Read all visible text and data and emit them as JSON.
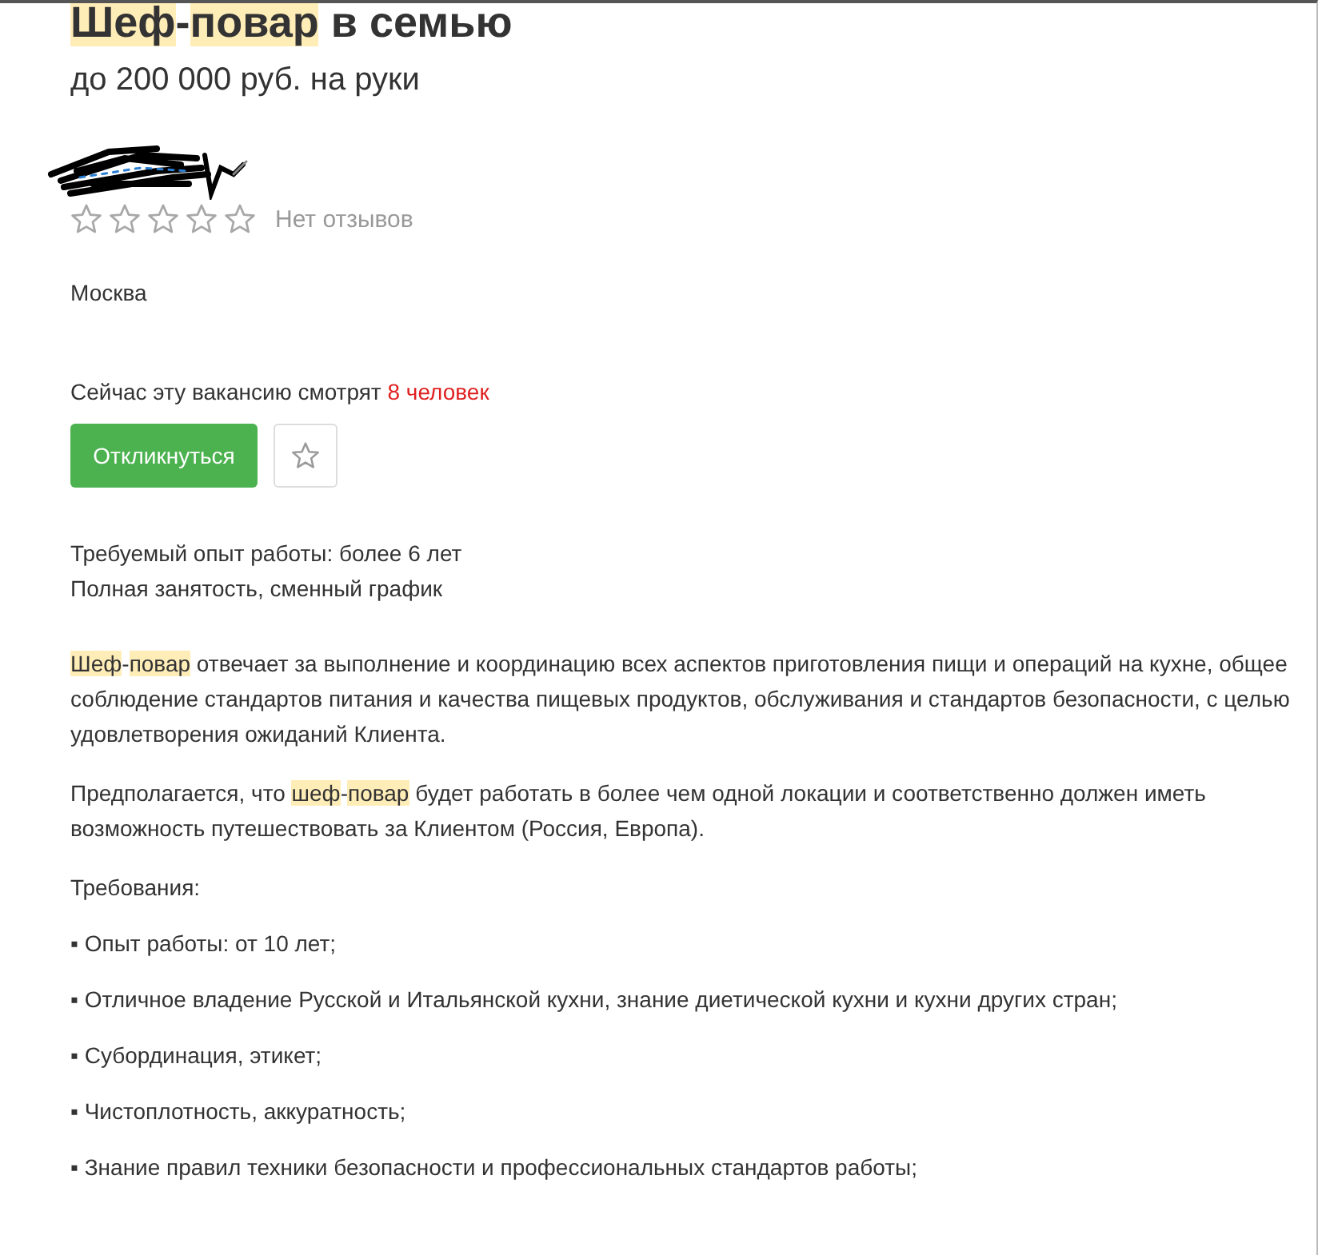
{
  "title": {
    "parts": [
      {
        "text": "Шеф",
        "highlighted": true
      },
      {
        "text": "-",
        "highlighted": false
      },
      {
        "text": "повар",
        "highlighted": true
      },
      {
        "text": " в семью",
        "highlighted": false
      }
    ]
  },
  "salary": "до 200 000 руб. на руки",
  "rating": {
    "stars": 0,
    "reviews": "Нет отзывов"
  },
  "city": "Москва",
  "viewers": {
    "text": "Сейчас эту вакансию смотрят ",
    "count": "8 человек"
  },
  "respond_button": "Откликнуться",
  "favorite": {
    "selected": false
  },
  "conditions": [
    "Требуемый опыт работы: более 6 лет",
    "Полная занятость, сменный график"
  ],
  "description": [
    {
      "kind": "paragraph",
      "parts": [
        {
          "text": "Шеф",
          "highlighted": true
        },
        {
          "text": "-",
          "highlighted": false
        },
        {
          "text": "повар",
          "highlighted": true
        },
        {
          "text": " отвечает за выполнение и координацию всех аспектов приготовления пищи и операций на кухне, общее соблюдение стандартов питания и качества пищевых продуктов, обслуживания и стандартов безопасности, с целью удовлетворения ожиданий Клиента.",
          "highlighted": false
        }
      ]
    },
    {
      "kind": "paragraph",
      "parts": [
        {
          "text": "Предполагается, что ",
          "highlighted": false
        },
        {
          "text": "шеф",
          "highlighted": true
        },
        {
          "text": "-",
          "highlighted": false
        },
        {
          "text": "повар",
          "highlighted": true
        },
        {
          "text": " будет работать в более чем одной локации и соответственно должен иметь возможность путешествовать за Клиентом (Россия, Европа).",
          "highlighted": false
        }
      ]
    },
    {
      "kind": "heading",
      "parts": [
        {
          "text": "Требования:",
          "highlighted": false
        }
      ]
    },
    {
      "kind": "item",
      "parts": [
        {
          "text": "▪ Опыт работы: от 10 лет;",
          "highlighted": false
        }
      ]
    },
    {
      "kind": "item",
      "parts": [
        {
          "text": "▪ Отличное владение Русской и Итальянской кухни, знание диетической кухни и кухни других стран;",
          "highlighted": false
        }
      ]
    },
    {
      "kind": "item",
      "parts": [
        {
          "text": "▪ Субординация, этикет;",
          "highlighted": false
        }
      ]
    },
    {
      "kind": "item",
      "parts": [
        {
          "text": "▪ Чистоплотность, аккуратность;",
          "highlighted": false
        }
      ]
    },
    {
      "kind": "item",
      "parts": [
        {
          "text": "▪ Знание правил техники безопасности и профессиональных стандартов работы;",
          "highlighted": false
        }
      ]
    }
  ]
}
